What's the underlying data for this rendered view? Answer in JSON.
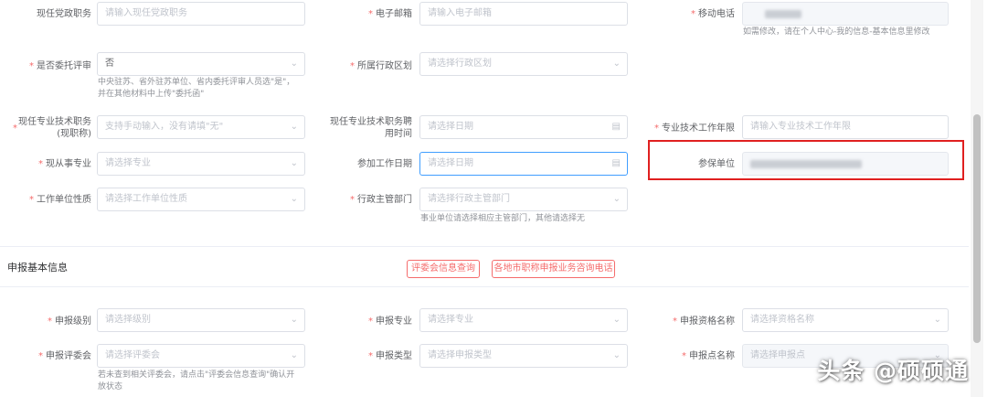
{
  "form": {
    "current_party_post": {
      "label": "现任党政职务",
      "placeholder": "请输入现任党政职务"
    },
    "email": {
      "label": "电子邮箱",
      "placeholder": "请输入电子邮箱"
    },
    "mobile": {
      "label": "移动电话",
      "hint": "如需修改，请在个人中心-我的信息-基本信息里修改"
    },
    "entrust_review": {
      "label": "是否委托评审",
      "value": "否",
      "hint_line1": "中央驻苏、省外驻苏单位、省内委托评审人员选\"是\"，",
      "hint_line2": "并在其他材料中上传\"委托函\""
    },
    "admin_region": {
      "label": "所属行政区划",
      "placeholder": "请选择行政区划"
    },
    "current_title": {
      "label_line1": "现任专业技术职务",
      "label_line2": "(现职称)",
      "placeholder": "支持手动输入，没有请填\"无\""
    },
    "title_appoint_date": {
      "label_line1": "现任专业技术职务聘",
      "label_line2": "用时间",
      "placeholder": "请选择日期"
    },
    "tech_work_years": {
      "label": "专业技术工作年限",
      "placeholder": "请输入专业技术工作年限"
    },
    "current_specialty": {
      "label": "现从事专业",
      "placeholder": "请选择专业"
    },
    "work_start_date": {
      "label": "参加工作日期",
      "placeholder": "请选择日期"
    },
    "insured_unit": {
      "label": "参保单位"
    },
    "unit_nature": {
      "label": "工作单位性质",
      "placeholder": "请选择工作单位性质"
    },
    "admin_dept": {
      "label": "行政主管部门",
      "placeholder": "请选择行政主管部门",
      "hint": "事业单位请选择相应主管部门，其他请选择无"
    }
  },
  "section": {
    "title": "申报基本信息",
    "btn_committee_query": "评委会信息查询",
    "btn_consult_phone": "各地市职称申报业务咨询电话"
  },
  "apply": {
    "level": {
      "label": "申报级别",
      "placeholder": "请选择级别"
    },
    "specialty": {
      "label": "申报专业",
      "placeholder": "请选择专业"
    },
    "qualification": {
      "label": "申报资格名称",
      "placeholder": "请选择资格名称"
    },
    "committee": {
      "label": "申报评委会",
      "placeholder": "请选择评委会",
      "hint_line1": "若未查到相关评委会，请点击\"评委会信息查询\"确认开",
      "hint_line2": "放状态"
    },
    "type": {
      "label": "申报类型",
      "placeholder": "请选择申报类型"
    },
    "point": {
      "label": "申报点名称",
      "placeholder": "请选择申报点"
    }
  },
  "icons": {
    "chevron": "chevron-down-icon",
    "calendar": "calendar-icon"
  },
  "watermark": "头条 @硕硕通",
  "colors": {
    "required": "#f56c6c",
    "highlight": "#e02020",
    "focus": "#409eff"
  }
}
